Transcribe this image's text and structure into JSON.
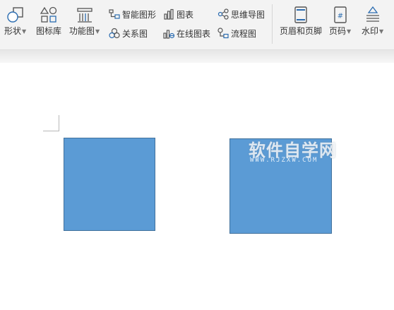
{
  "toolbar": {
    "shape": "形状",
    "icon_library": "图标库",
    "function_chart": "功能图",
    "smart_graphic": "智能图形",
    "chart": "图表",
    "mind_map": "思维导图",
    "relation_chart": "关系图",
    "online_chart": "在线图表",
    "flow_chart": "流程图",
    "header_footer": "页眉和页脚",
    "page_number": "页码",
    "watermark": "水印"
  },
  "watermark": {
    "title": "软件自学网",
    "subtitle": "WWW.RJZXW.COM"
  },
  "colors": {
    "shape_fill": "#5b9bd5",
    "shape_border": "#41719c",
    "icon_blue": "#2b6cb0"
  }
}
